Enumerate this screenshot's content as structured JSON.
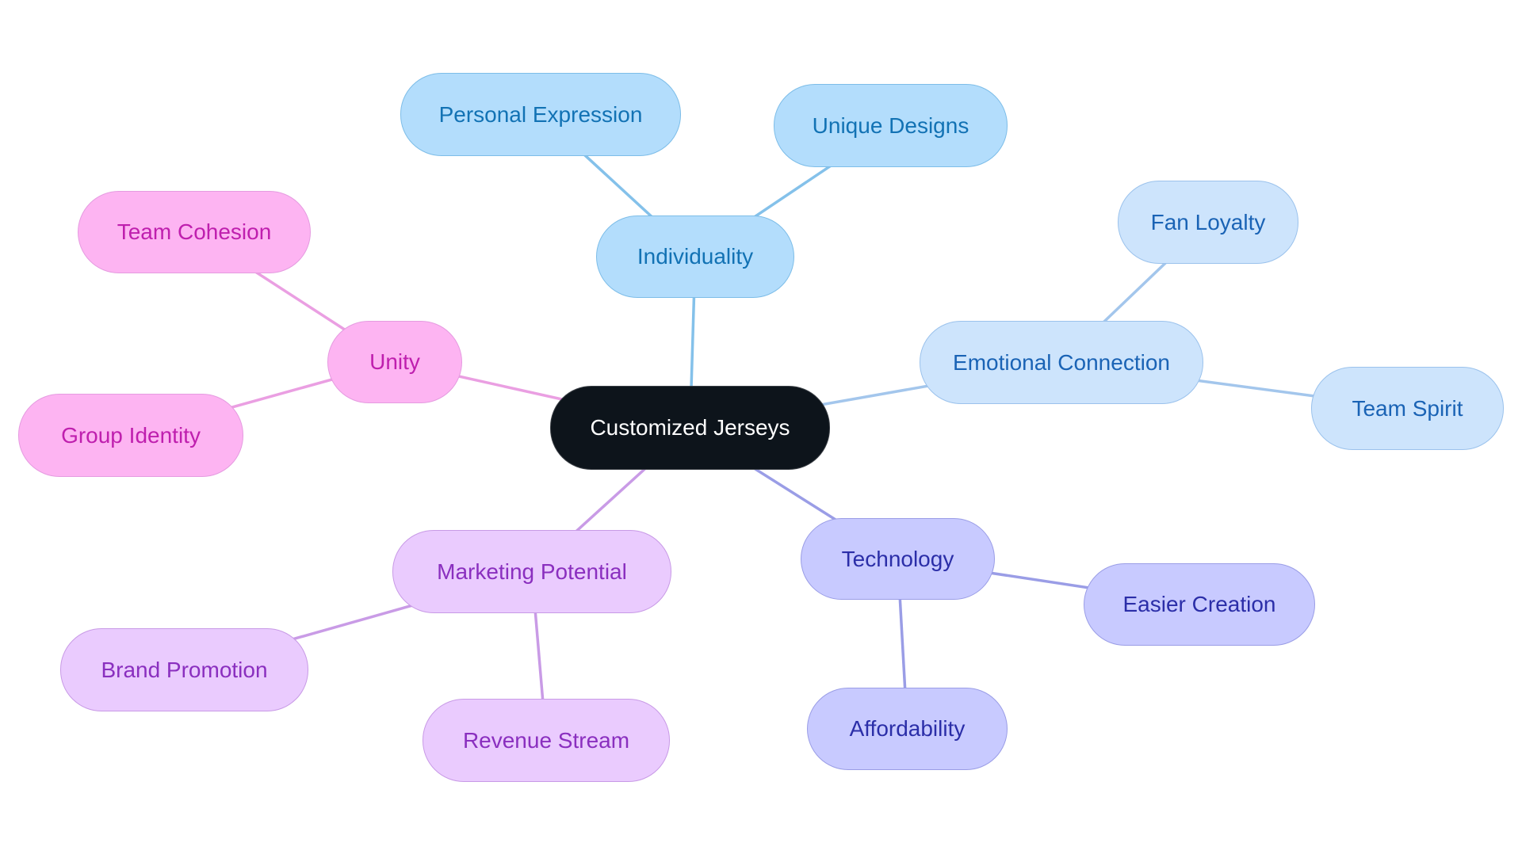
{
  "diagram": {
    "type": "mindmap",
    "root": {
      "id": "root",
      "label": "Customized Jerseys"
    },
    "branches": [
      {
        "id": "individuality",
        "label": "Individuality",
        "color": "blue",
        "children": [
          {
            "id": "personal-expression",
            "label": "Personal Expression"
          },
          {
            "id": "unique-designs",
            "label": "Unique Designs"
          }
        ]
      },
      {
        "id": "emotional-connection",
        "label": "Emotional Connection",
        "color": "lblue",
        "children": [
          {
            "id": "fan-loyalty",
            "label": "Fan Loyalty"
          },
          {
            "id": "team-spirit",
            "label": "Team Spirit"
          }
        ]
      },
      {
        "id": "technology",
        "label": "Technology",
        "color": "indigo",
        "children": [
          {
            "id": "easier-creation",
            "label": "Easier Creation"
          },
          {
            "id": "affordability",
            "label": "Affordability"
          }
        ]
      },
      {
        "id": "marketing-potential",
        "label": "Marketing Potential",
        "color": "lilac",
        "children": [
          {
            "id": "brand-promotion",
            "label": "Brand Promotion"
          },
          {
            "id": "revenue-stream",
            "label": "Revenue Stream"
          }
        ]
      },
      {
        "id": "unity",
        "label": "Unity",
        "color": "pink",
        "children": [
          {
            "id": "team-cohesion",
            "label": "Team Cohesion"
          },
          {
            "id": "group-identity",
            "label": "Group Identity"
          }
        ]
      }
    ],
    "colors": {
      "root": "#0d141b",
      "blue": {
        "edge": "#84c1ea"
      },
      "lblue": {
        "edge": "#a3c6ec"
      },
      "indigo": {
        "edge": "#9a9de6"
      },
      "lilac": {
        "edge": "#c99be6"
      },
      "pink": {
        "edge": "#ea9fe2"
      }
    }
  }
}
